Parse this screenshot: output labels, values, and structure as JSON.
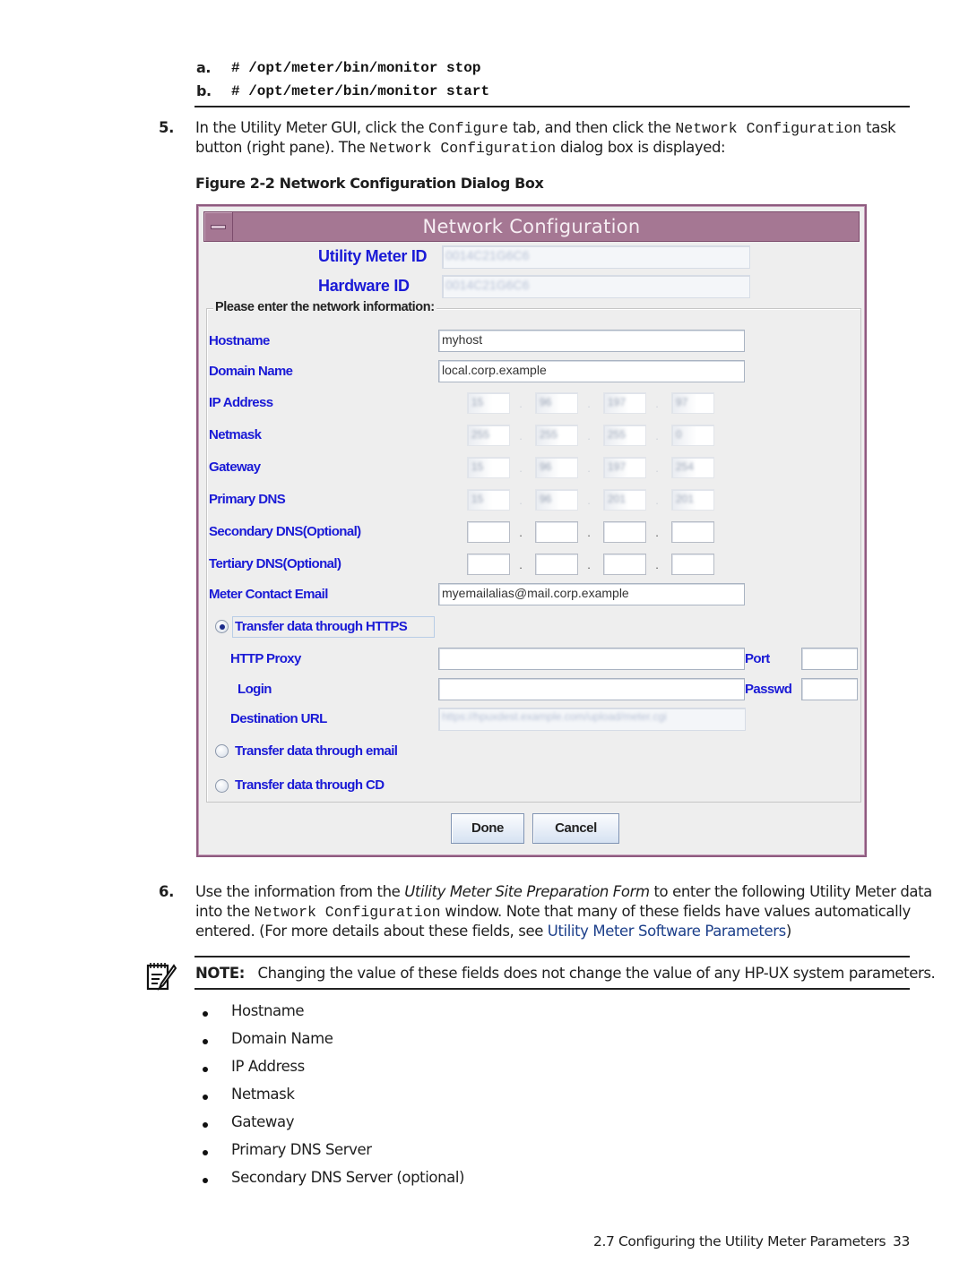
{
  "steps_sub": [
    {
      "marker": "a.",
      "command": "# /opt/meter/bin/monitor stop"
    },
    {
      "marker": "b.",
      "command": "# /opt/meter/bin/monitor start"
    }
  ],
  "step5": {
    "number": "5.",
    "t1": "In the Utility Meter GUI, click the ",
    "code1": "Configure",
    "t2": " tab, and then click the ",
    "code2": "Network Configuration",
    "t3": " task",
    "t4": "button (right pane). The ",
    "code3": "Network Configuration",
    "t5": " dialog box is displayed:"
  },
  "figure_caption": "Figure 2-2 Network Configuration Dialog Box",
  "dialog": {
    "title": "Network Configuration",
    "utility_meter_id_label": "Utility Meter ID",
    "utility_meter_id_value": "0014C21G6C6",
    "hardware_id_label": "Hardware ID",
    "hardware_id_value": "0014C21G6C6",
    "group_title": "Please enter the network information:",
    "hostname_label": "Hostname",
    "hostname_value": "myhost",
    "domain_label": "Domain Name",
    "domain_value": "local.corp.example",
    "ip_rows": [
      {
        "label": "IP Address",
        "octets": [
          "15",
          "96",
          "197",
          "97"
        ],
        "disabled": true
      },
      {
        "label": "Netmask",
        "octets": [
          "255",
          "255",
          "255",
          "0"
        ],
        "disabled": true
      },
      {
        "label": "Gateway",
        "octets": [
          "15",
          "96",
          "197",
          "254"
        ],
        "disabled": true
      },
      {
        "label": "Primary DNS",
        "octets": [
          "15",
          "96",
          "201",
          "201"
        ],
        "disabled": true
      },
      {
        "label": "Secondary DNS(Optional)",
        "octets": [
          "",
          "",
          "",
          ""
        ],
        "disabled": false
      },
      {
        "label": "Tertiary DNS(Optional)",
        "octets": [
          "",
          "",
          "",
          ""
        ],
        "disabled": false
      }
    ],
    "octet_separator": ".",
    "email_label": "Meter Contact Email",
    "email_value": "myemailalias@mail.corp.example",
    "radio_https": {
      "label": "Transfer data through HTTPS",
      "checked": true
    },
    "proxy_label": "HTTP Proxy",
    "proxy_value": "",
    "port_label": "Port",
    "port_value": "",
    "login_label": "Login",
    "login_value": "",
    "passwd_label": "Passwd",
    "passwd_value": "",
    "dest_url_label": "Destination URL",
    "dest_url_value": "https://hpuxdest.example.com/upload/meter.cgi",
    "radio_email": {
      "label": "Transfer data through email",
      "checked": false
    },
    "radio_cd": {
      "label": "Transfer data through CD",
      "checked": false
    },
    "done_label": "Done",
    "cancel_label": "Cancel"
  },
  "step6": {
    "number": "6.",
    "t1": "Use the information from the ",
    "italic": "Utility Meter Site Preparation Form",
    "t2": " to enter the following Utility Meter data",
    "t3": "into the ",
    "code": "Network Configuration",
    "t4": " window. Note that many of these fields have values automatically",
    "t5": "entered. (For more details about these fields, see ",
    "link": "Utility Meter Software Parameters",
    "t6": ")"
  },
  "note": {
    "icon": "note-pencil-icon",
    "label": "NOTE:",
    "text": "Changing the value of these fields does not change the value of any HP-UX system parameters."
  },
  "bullets": [
    "Hostname",
    "Domain Name",
    "IP Address",
    "Netmask",
    "Gateway",
    "Primary DNS Server",
    "Secondary DNS Server (optional)"
  ],
  "footer": {
    "section": "2.7 Configuring the Utility Meter Parameters",
    "page": "33"
  },
  "colors": {
    "label_blue": "#1a1ad6",
    "titlebar": "#a57793",
    "link": "#1c3f8a"
  }
}
